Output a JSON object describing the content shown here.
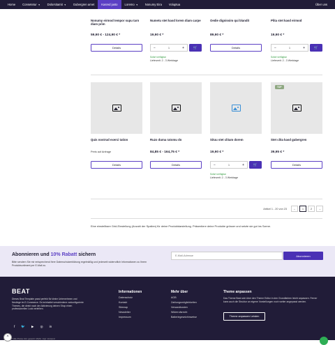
{
  "nav": {
    "items": [
      {
        "label": "Home",
        "active": false,
        "dropdown": false
      },
      {
        "label": "Consetetur",
        "active": false,
        "dropdown": true
      },
      {
        "label": "Dolorsitamit",
        "active": false,
        "dropdown": true
      },
      {
        "label": "Gubergren amet",
        "active": false,
        "dropdown": false
      },
      {
        "label": "Kasred justo",
        "active": true,
        "dropdown": false
      },
      {
        "label": "Loremo",
        "active": false,
        "dropdown": true
      },
      {
        "label": "Nonumy Eira",
        "active": false,
        "dropdown": false
      },
      {
        "label": "Voluptua",
        "active": false,
        "dropdown": false
      }
    ],
    "right_link": "Über uns"
  },
  "row1": [
    {
      "name": "Nonumy eirmod tempor supu tarn diam prim",
      "price": "59,90 € - 124,90 € *",
      "button": "Details"
    },
    {
      "name": "Numetu stet kasd lorem diam carpe",
      "price": "19,90 € *",
      "qty": "1",
      "minus": "−",
      "plus": "+",
      "cart_icon": "cart-icon",
      "stock": "Sofort verfügbar",
      "delivery": "Lieferzeit: 2 - 3 Werktage"
    },
    {
      "name": "Oedie dignissim qui blandit",
      "price": "89,90 € *",
      "button": "Details"
    },
    {
      "name": "Plita stet kasd eirmod",
      "price": "19,90 € *",
      "qty": "1",
      "minus": "−",
      "plus": "+",
      "cart_icon": "cart-icon",
      "stock": "Sofort verfügbar",
      "delivery": "Lieferzeit: 2 - 3 Werktage"
    }
  ],
  "row2": [
    {
      "name": "Quis nostrud exerci tation",
      "note": "Preis auf Anfrage",
      "button": "Details"
    },
    {
      "name": "Ruzo duma ratomu do",
      "price": "84,85 € - 164,75 € *",
      "button": "Details"
    },
    {
      "name": "Situu stet clitam dorem",
      "price": "19,90 € *",
      "qty": "1",
      "minus": "−",
      "plus": "+",
      "cart_icon": "cart-icon",
      "stock": "Sofort verfügbar",
      "delivery": "Lieferzeit: 2 - 3 Werktage"
    },
    {
      "name": "Stet clita kasd gubergren",
      "price": "39,95 € *",
      "button": "Details",
      "badge": "TOP"
    }
  ],
  "pagination": {
    "label": "Artikel 1 - 20 von 23",
    "prev": "←",
    "pages": [
      "1",
      "2"
    ],
    "current": "1",
    "next": "→"
  },
  "info_text": "Eine einstellbare Grid-Einstellung (Anzahl der Spalten) für deine Produktdarstellung. Präsentiere deine Produkte grösser und setzte sie gut ins Szene.",
  "newsletter": {
    "title_prefix": "Abonnieren und ",
    "title_accent": "10% Rabatt",
    "title_suffix": " sichern",
    "description": "Bitte sendern Sie mir entsprechend Ihrer Datenschutzerklärung regelmäßig und jederzeit widerruflich Informationen zu Ihrem Produktsortiment per E-Mail zu.",
    "email_placeholder": "E-Mail-Adresse",
    "button": "Abonnieren"
  },
  "footer": {
    "logo": "BEAT",
    "about": "Dieses Beat Template passt perfekt für kleine Unternehmen und Neulinge im E-Commerce. Es beinhaltet verschiedene vorkonfigurierte Themes, die direkt nach der Aktivierung deinen Shop einen professionellen Look verleihen.",
    "social": [
      "f",
      "🐦",
      "▶",
      "◎",
      "in"
    ],
    "col1_title": "Informationen",
    "col1_items": [
      "Datenschutz",
      "Kontakt",
      "Sitemap",
      "Newsletter",
      "Impressum"
    ],
    "col2_title": "Mehr über",
    "col2_items": [
      "AGB",
      "Zahlungsmöglichkeiten",
      "Versandkosten",
      "Widerrufsrecht",
      "Batteriegesetzhinweise"
    ],
    "col3_title": "Theme anpassen",
    "col3_text": "Das Theme Beat sich über den Theme Editor in den Grundfarben leicht anpassen. Ferner kann auch die Struktur an eigene Vorstellungen noch weiter angepasst werden.",
    "theme_button": "Theme anpassen Leisten",
    "copyright": "* Alle Preise inkl. gesetzl. MwSt. zzgl. Versand",
    "scroll_top": "^"
  },
  "colors": {
    "primary": "#5b3fc4",
    "dark": "#211c38",
    "stock": "#2e9a3c",
    "badge": "#8fa882"
  }
}
